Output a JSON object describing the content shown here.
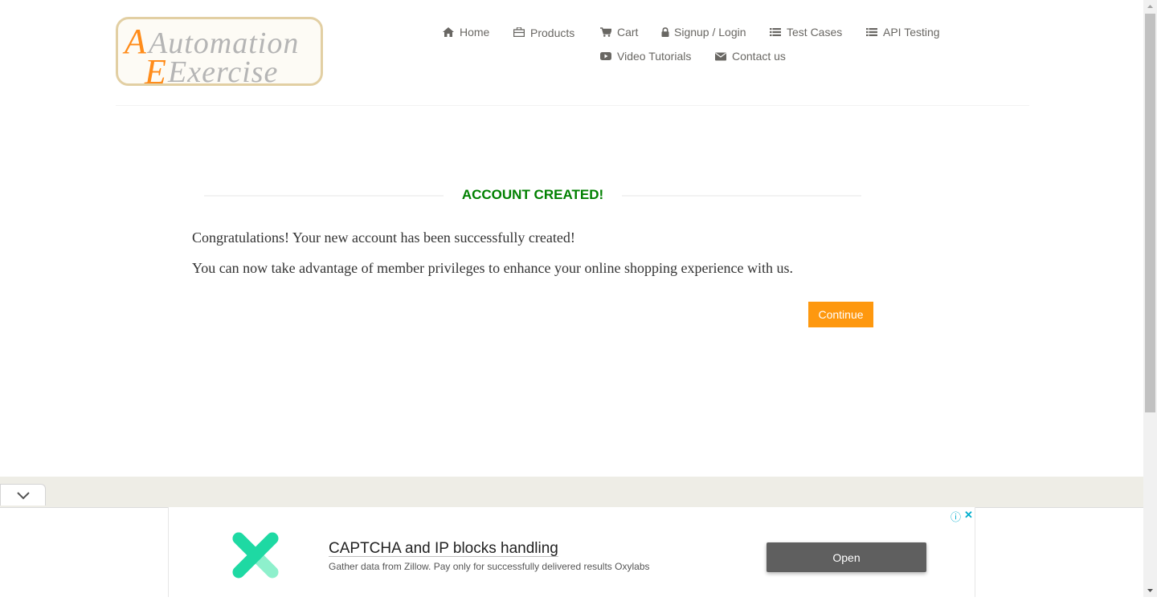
{
  "logo": {
    "line1": "Automation",
    "line2": "Exercise",
    "accent_color": "#ff8c1a"
  },
  "nav": {
    "home": "Home",
    "products": "Products",
    "cart": "Cart",
    "signup_login": "Signup / Login",
    "test_cases": "Test Cases",
    "api_testing": "API Testing",
    "video_tutorials": "Video Tutorials",
    "contact_us": "Contact us",
    "icons": [
      "home-icon",
      "briefcase-icon",
      "cart-icon",
      "lock-icon",
      "list-icon",
      "list-icon",
      "youtube-icon",
      "envelope-icon"
    ]
  },
  "main": {
    "title": "ACCOUNT CREATED!",
    "title_color": "#008000",
    "message1": "Congratulations! Your new account has been successfully created!",
    "message2": "You can now take advantage of member privileges to enhance your online shopping experience with us.",
    "continue_label": "Continue",
    "button_color": "#fe980f"
  },
  "ad": {
    "headline": "CAPTCHA and IP blocks handling",
    "subtext": "Gather data from Zillow. Pay only for successfully delivered results Oxylabs",
    "open_label": "Open",
    "info_glyph": "ⓘ",
    "close_glyph": "✕",
    "brand_colors": [
      "#1ed9a3",
      "#8ef0cc"
    ]
  }
}
